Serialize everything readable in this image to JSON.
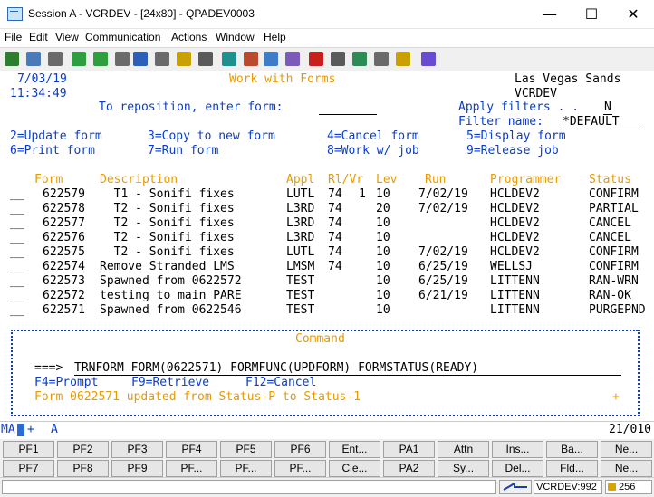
{
  "window": {
    "title": "Session A - VCRDEV - [24x80] - QPADEV0003",
    "minimize": "—",
    "maximize": "☐",
    "close": "✕"
  },
  "menu": [
    "File",
    "Edit",
    "View",
    "Communication",
    "Actions",
    "Window",
    "Help"
  ],
  "toolbar_icons": [
    "copy-icon",
    "paste-icon",
    "print-icon",
    "send-icon",
    "receive-icon",
    "display-icon",
    "browser-icon",
    "macro-icon",
    "document-icon",
    "settings-icon",
    "keyboard-icon",
    "color-icon",
    "grid-icon",
    "edit-icon",
    "record-icon",
    "stop-icon",
    "play-icon",
    "pause-icon",
    "notes-icon",
    "help-icon"
  ],
  "screen": {
    "date": "7/03/19",
    "time": "11:34:49",
    "title": "Work with Forms",
    "company": "Las Vegas Sands",
    "system": "VCRDEV",
    "reposition_label": "To reposition, enter form:",
    "reposition_value": "",
    "apply_filters_label": "Apply filters . .",
    "apply_filters_value": "N",
    "filter_name_label": "Filter name:",
    "filter_name_value": "*DEFAULT",
    "options": [
      "2=Update form",
      "3=Copy to new form",
      "4=Cancel form",
      "5=Display form",
      "6=Print form",
      "7=Run form",
      "8=Work w/ job",
      "9=Release job"
    ],
    "columns": {
      "form": "Form",
      "description": "Description",
      "appl": "Appl",
      "rlvr": "Rl/Vr",
      "lev": "Lev",
      "run": "Run",
      "programmer": "Programmer",
      "status": "Status"
    },
    "rows": [
      {
        "opt": "__",
        "form": "622579",
        "desc": "  T1 - Sonifi fixes",
        "appl": "LUTL",
        "rl": "74",
        "vr": "1",
        "lev": "10",
        "run": "7/02/19",
        "prog": "HCLDEV2",
        "status": "CONFIRM"
      },
      {
        "opt": "__",
        "form": "622578",
        "desc": "  T2 - Sonifi fixes",
        "appl": "L3RD",
        "rl": "74",
        "vr": "",
        "lev": "20",
        "run": "7/02/19",
        "prog": "HCLDEV2",
        "status": "PARTIAL"
      },
      {
        "opt": "__",
        "form": "622577",
        "desc": "  T2 - Sonifi fixes",
        "appl": "L3RD",
        "rl": "74",
        "vr": "",
        "lev": "10",
        "run": "",
        "prog": "HCLDEV2",
        "status": "CANCEL"
      },
      {
        "opt": "__",
        "form": "622576",
        "desc": "  T2 - Sonifi fixes",
        "appl": "L3RD",
        "rl": "74",
        "vr": "",
        "lev": "10",
        "run": "",
        "prog": "HCLDEV2",
        "status": "CANCEL"
      },
      {
        "opt": "__",
        "form": "622575",
        "desc": "  T2 - Sonifi fixes",
        "appl": "LUTL",
        "rl": "74",
        "vr": "",
        "lev": "10",
        "run": "7/02/19",
        "prog": "HCLDEV2",
        "status": "CONFIRM"
      },
      {
        "opt": "__",
        "form": "622574",
        "desc": "Remove Stranded LMS",
        "appl": "LMSM",
        "rl": "74",
        "vr": "",
        "lev": "10",
        "run": "6/25/19",
        "prog": "WELLSJ",
        "status": "CONFIRM"
      },
      {
        "opt": "__",
        "form": "622573",
        "desc": "Spawned from 0622572",
        "appl": "TEST",
        "rl": "",
        "vr": "",
        "lev": "10",
        "run": "6/25/19",
        "prog": "LITTENN",
        "status": "RAN-WRN"
      },
      {
        "opt": "__",
        "form": "622572",
        "desc": "testing to main PARE",
        "appl": "TEST",
        "rl": "",
        "vr": "",
        "lev": "10",
        "run": "6/21/19",
        "prog": "LITTENN",
        "status": "RAN-OK"
      },
      {
        "opt": "__",
        "form": "622571",
        "desc": "Spawned from 0622546",
        "appl": "TEST",
        "rl": "",
        "vr": "",
        "lev": "10",
        "run": "",
        "prog": "LITTENN",
        "status": "PURGEPND"
      }
    ],
    "command_title": "Command",
    "command_prompt": "===>",
    "command_value": "TRNFORM FORM(0622571) FORMFUNC(UPDFORM) FORMSTATUS(READY)",
    "fkeys": [
      "F4=Prompt",
      "F9=Retrieve",
      "F12=Cancel"
    ],
    "message": "Form 0622571 updated from Status-P to Status-1",
    "more_indicator": "+"
  },
  "oia": {
    "mode": "MA",
    "insert": "+",
    "field": "A",
    "position": "21/010"
  },
  "keypad": {
    "row1": [
      "PF1",
      "PF2",
      "PF3",
      "PF4",
      "PF5",
      "PF6",
      "Ent...",
      "PA1",
      "Attn",
      "Ins...",
      "Ba...",
      "Ne..."
    ],
    "row2": [
      "PF7",
      "PF8",
      "PF9",
      "PF...",
      "PF...",
      "PF...",
      "Cle...",
      "PA2",
      "Sy...",
      "Del...",
      "Fld...",
      "Ne..."
    ]
  },
  "statusbar": {
    "session": "VCRDEV:992",
    "lock": "256"
  },
  "colors": {
    "field": "#0a3dc8",
    "heading": "#e89b00",
    "text": "#000000"
  }
}
